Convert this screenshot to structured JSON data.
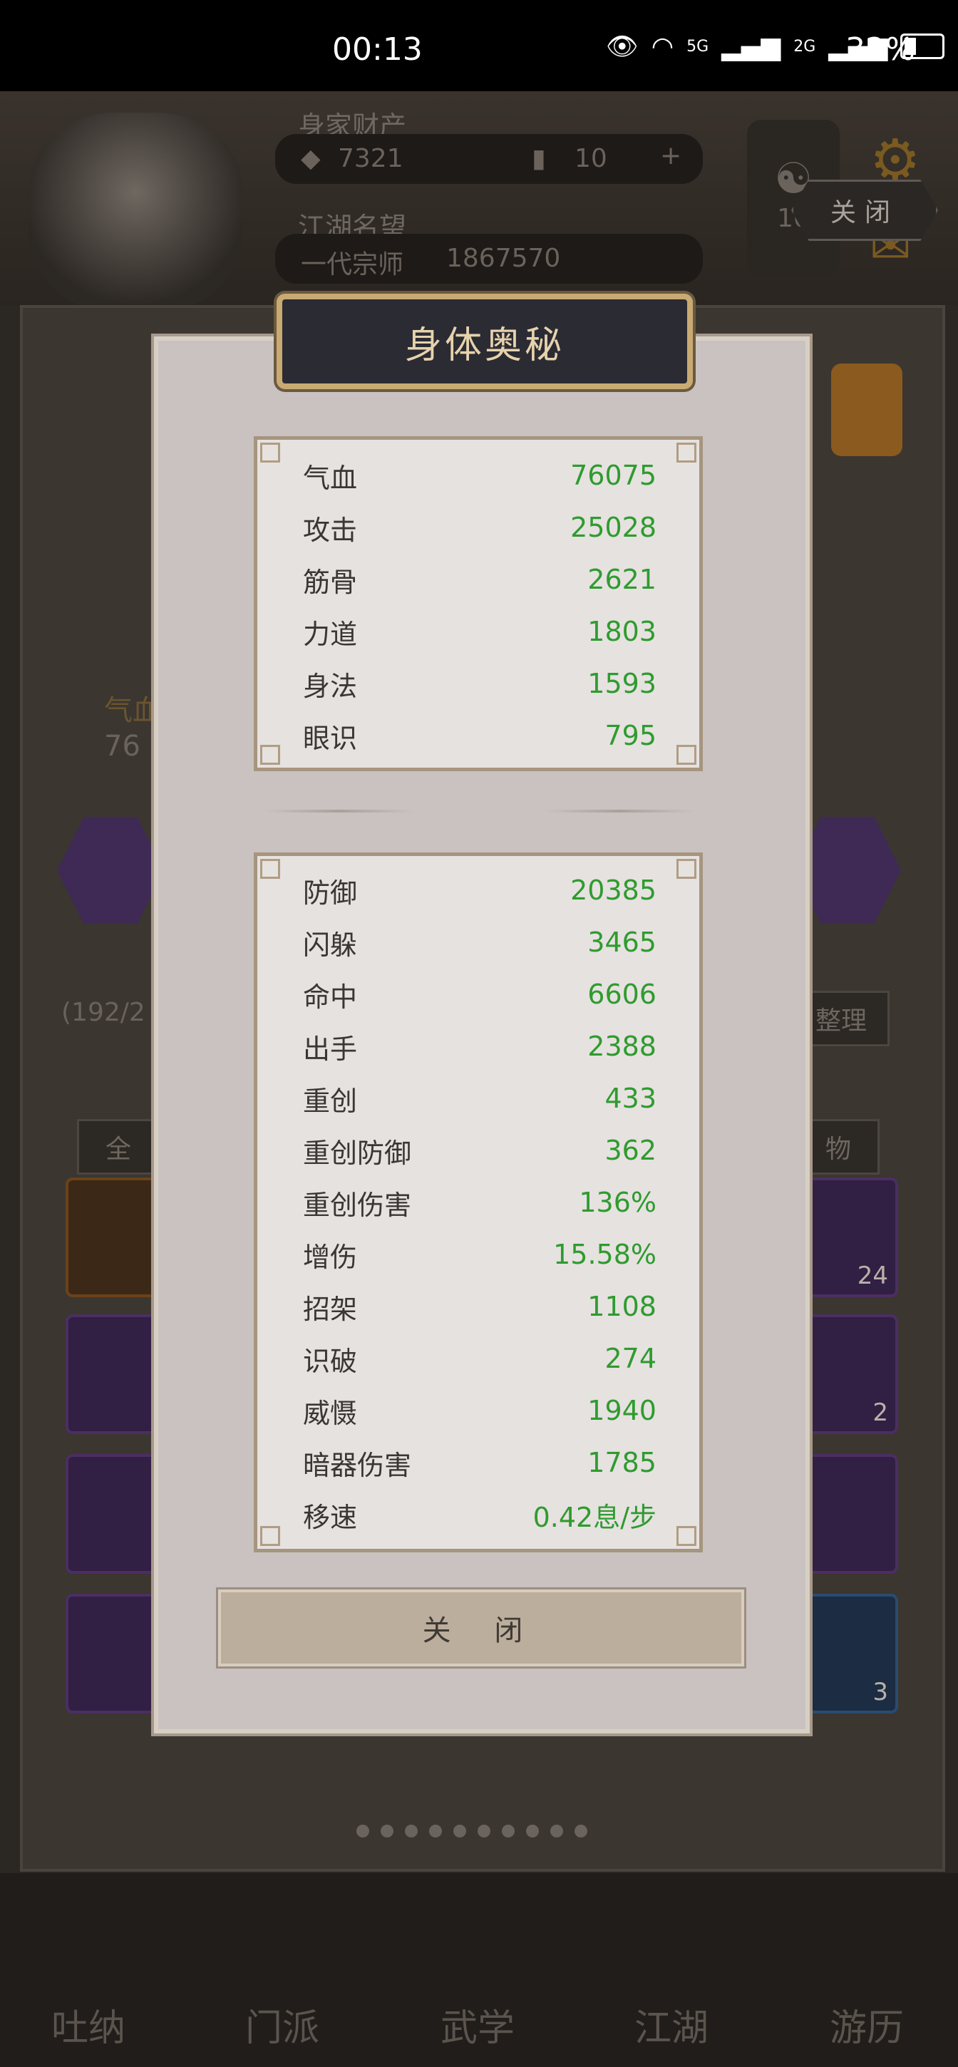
{
  "status_bar": {
    "time": "00:13",
    "network_1": "5G",
    "network_2": "2G",
    "battery": "32%"
  },
  "background": {
    "assets_label": "身家财产",
    "gold": "7321",
    "jade": "10",
    "plus": "+",
    "fame_label": "江湖名望",
    "rank": "一代宗师",
    "fame_value": "1867570",
    "badge_value": "10",
    "close_top": "关闭",
    "hp_fragment": "气血",
    "hp_value_fragment": "76",
    "inventory_count": "(192/2",
    "sort_button": "整理",
    "filter_all": "全",
    "filter_items": "物",
    "slot_counts": [
      "24",
      "2",
      "3"
    ],
    "tabs": [
      "吐纳",
      "门派",
      "武学",
      "江湖",
      "游历"
    ]
  },
  "modal": {
    "title": "身体奥秘",
    "primary_stats": [
      {
        "name": "气血",
        "value": "76075"
      },
      {
        "name": "攻击",
        "value": "25028"
      },
      {
        "name": "筋骨",
        "value": "2621"
      },
      {
        "name": "力道",
        "value": "1803"
      },
      {
        "name": "身法",
        "value": "1593"
      },
      {
        "name": "眼识",
        "value": "795"
      }
    ],
    "secondary_stats": [
      {
        "name": "防御",
        "value": "20385"
      },
      {
        "name": "闪躲",
        "value": "3465"
      },
      {
        "name": "命中",
        "value": "6606"
      },
      {
        "name": "出手",
        "value": "2388"
      },
      {
        "name": "重创",
        "value": "433"
      },
      {
        "name": "重创防御",
        "value": "362"
      },
      {
        "name": "重创伤害",
        "value": "136%"
      },
      {
        "name": "增伤",
        "value": "15.58%"
      },
      {
        "name": "招架",
        "value": "1108"
      },
      {
        "name": "识破",
        "value": "274"
      },
      {
        "name": "威慑",
        "value": "1940"
      },
      {
        "name": "暗器伤害",
        "value": "1785"
      },
      {
        "name": "移速",
        "value": "0.42息/步"
      }
    ],
    "close_label": "关 闭"
  },
  "colors": {
    "stat_value": "#2f9b2f",
    "title_text": "#e6d2ac",
    "modal_bg": "#c9c2c1"
  }
}
